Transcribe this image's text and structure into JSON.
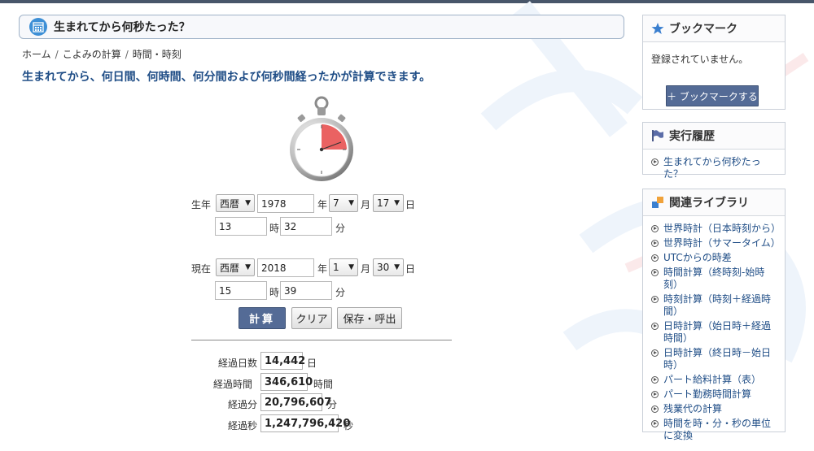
{
  "page": {
    "title": "生まれてから何秒たった？",
    "breadcrumb": [
      "ホーム",
      "こよみの計算",
      "時間・時刻"
    ],
    "description": "生まれてから、何日間、何時間、何分間および何秒間経ったかが計算できます。"
  },
  "birth": {
    "label": "生年",
    "era": "西暦",
    "year": "1978",
    "year_unit": "年",
    "month": "7",
    "month_unit": "月",
    "day": "17",
    "day_unit": "日",
    "hour": "13",
    "hour_unit": "時",
    "minute": "32",
    "minute_unit": "分"
  },
  "now": {
    "label": "現在",
    "era": "西暦",
    "year": "2018",
    "year_unit": "年",
    "month": "1",
    "month_unit": "月",
    "day": "30",
    "day_unit": "日",
    "hour": "15",
    "hour_unit": "時",
    "minute": "39",
    "minute_unit": "分"
  },
  "buttons": {
    "calc": "計算",
    "clear": "クリア",
    "save": "保存・呼出"
  },
  "results": [
    {
      "label": "経過日数",
      "value": "14,442",
      "unit": "日"
    },
    {
      "label": "経過時間",
      "value": "346,610",
      "unit": "時間"
    },
    {
      "label": "経過分",
      "value": "20,796,607",
      "unit": "分"
    },
    {
      "label": "経過秒",
      "value": "1,247,796,420",
      "unit": "秒"
    }
  ],
  "sidebar": {
    "bookmark": {
      "title": "ブックマーク",
      "empty_text": "登録されていません。",
      "button": "＋ ブックマークする"
    },
    "history": {
      "title": "実行履歴",
      "items": [
        "生まれてから何秒たった？"
      ]
    },
    "library": {
      "title": "関連ライブラリ",
      "items": [
        "世界時計（日本時刻から）",
        "世界時計（サマータイム）",
        "UTCからの時差",
        "時間計算（終時刻-始時刻）",
        "時刻計算（時刻＋経過時間）",
        "日時計算（始日時＋経過時間）",
        "日時計算（終日時－始日時）",
        "パート給料計算（表）",
        "パート勤務時間計算",
        "残業代の計算",
        "時間を時・分・秒の単位に変換"
      ]
    }
  },
  "colors": {
    "accent": "#546b96",
    "heading_blue": "#1f4d86",
    "icon_blue": "#3d8fd6"
  }
}
